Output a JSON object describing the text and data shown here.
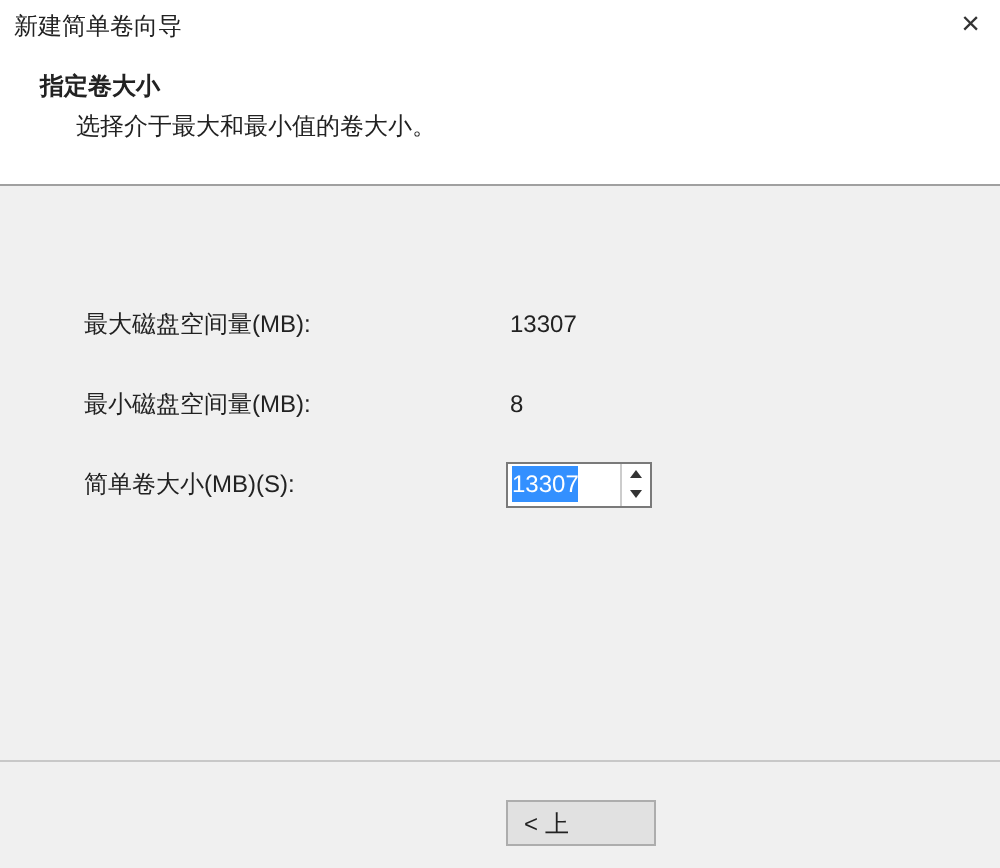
{
  "window": {
    "title": "新建简单卷向导",
    "close_glyph": "×"
  },
  "header": {
    "title": "指定卷大小",
    "subtitle": "选择介于最大和最小值的卷大小。"
  },
  "fields": [
    {
      "kind": "text",
      "label": "最大磁盘空间量(MB):",
      "value": "13307"
    },
    {
      "kind": "text",
      "label": "最小磁盘空间量(MB):",
      "value": "8"
    },
    {
      "kind": "spinner",
      "label": "简单卷大小(MB)(S):",
      "value": "13307",
      "text_selected": true
    }
  ],
  "buttons": [
    {
      "label": "< 上"
    }
  ]
}
